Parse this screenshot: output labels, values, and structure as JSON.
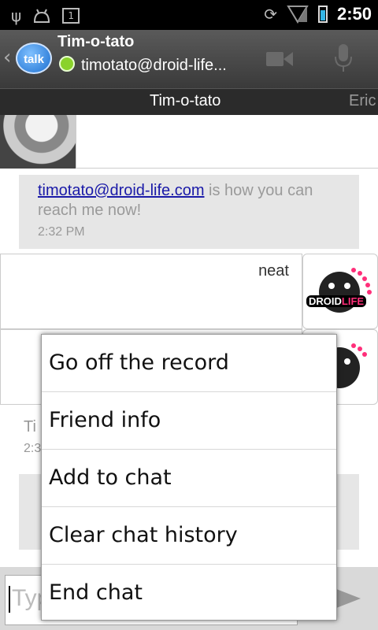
{
  "status_bar": {
    "time": "2:50",
    "icons": [
      "usb-icon",
      "android-debug-icon",
      "notification-count-icon",
      "sync-icon",
      "signal-icon",
      "battery-icon"
    ],
    "notification_count": "1"
  },
  "title_bar": {
    "app_logo_text": "talk",
    "contact_name": "Tim-o-tato",
    "contact_email": "timotato@droid-life...",
    "presence_color": "#8ad22b",
    "icons": [
      "back-chevron-icon",
      "video-chat-icon",
      "voice-chat-icon"
    ]
  },
  "chat_tabs": [
    {
      "label": "Tim-o-tato",
      "active": true
    },
    {
      "label": "Eric",
      "active": false
    }
  ],
  "conversation": {
    "messages": [
      {
        "type": "incoming",
        "link": "timotato@droid-life.com",
        "text": " is how you can reach me now!",
        "time": "2:32 PM"
      },
      {
        "type": "outgoing",
        "text": "neat"
      },
      {
        "type": "incoming-partial",
        "text_start": "Ti",
        "time_start": "2:3"
      }
    ],
    "logo_text_dark": "DROID",
    "logo_text_accent": "LIFE",
    "accent_color": "#ff2f7a"
  },
  "composer": {
    "placeholder_partial": "Type",
    "icons": [
      "send-icon"
    ]
  },
  "context_menu": {
    "items": [
      "Go off the record",
      "Friend info",
      "Add to chat",
      "Clear chat history",
      "End chat"
    ]
  }
}
